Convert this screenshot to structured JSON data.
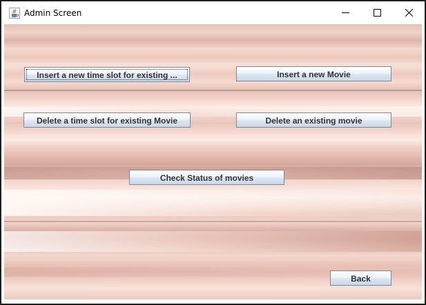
{
  "window": {
    "title": "Admin Screen",
    "icon": "java-cup-icon",
    "controls": [
      "minimize-icon",
      "maximize-icon",
      "close-icon"
    ]
  },
  "buttons": {
    "insert_slot": "Insert a new time slot for existing ...",
    "insert_movie": "Insert a new Movie",
    "delete_slot": "Delete a  time slot for existing Movie",
    "delete_movie": "Delete an existing movie",
    "check_status": "Check Status of movies",
    "back": "Back"
  },
  "colors": {
    "button_border": "#7a8a99",
    "button_text": "#333333",
    "background_tone": "#efc9bd"
  }
}
